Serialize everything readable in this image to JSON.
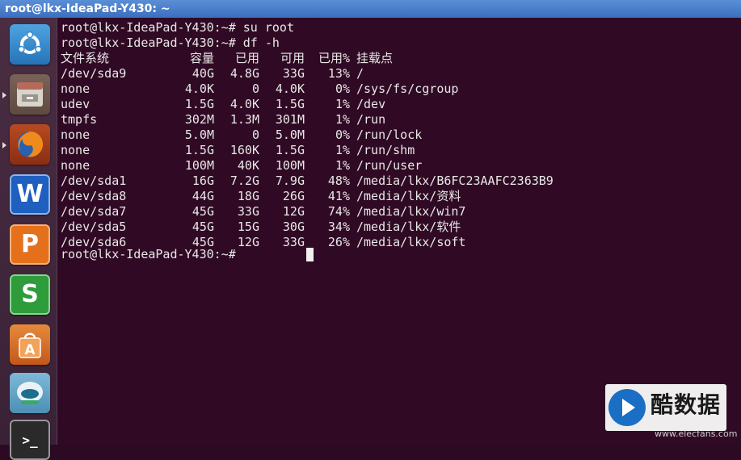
{
  "window": {
    "title": "root@lkx-IdeaPad-Y430: ~"
  },
  "launcher": {
    "items": [
      {
        "name": "ubuntu-dash-icon"
      },
      {
        "name": "files-icon"
      },
      {
        "name": "firefox-icon"
      },
      {
        "name": "wps-writer-icon",
        "letter": "W",
        "color": "#1e5fbf"
      },
      {
        "name": "wps-presentation-icon",
        "letter": "P",
        "color": "#e5701c"
      },
      {
        "name": "wps-spreadsheet-icon",
        "letter": "S",
        "color": "#2e9c3a"
      },
      {
        "name": "software-center-icon"
      },
      {
        "name": "system-updater-icon"
      },
      {
        "name": "terminal-icon",
        "glyph": ">_"
      }
    ]
  },
  "terminal": {
    "commands": [
      "root@lkx-IdeaPad-Y430:~# su root",
      "root@lkx-IdeaPad-Y430:~# df -h"
    ],
    "headers": [
      "文件系统",
      "容量",
      "已用",
      "可用",
      "已用%",
      "挂载点"
    ],
    "rows": [
      [
        "/dev/sda9",
        "40G",
        "4.8G",
        "33G",
        "13%",
        "/"
      ],
      [
        "none",
        "4.0K",
        "0",
        "4.0K",
        "0%",
        "/sys/fs/cgroup"
      ],
      [
        "udev",
        "1.5G",
        "4.0K",
        "1.5G",
        "1%",
        "/dev"
      ],
      [
        "tmpfs",
        "302M",
        "1.3M",
        "301M",
        "1%",
        "/run"
      ],
      [
        "none",
        "5.0M",
        "0",
        "5.0M",
        "0%",
        "/run/lock"
      ],
      [
        "none",
        "1.5G",
        "160K",
        "1.5G",
        "1%",
        "/run/shm"
      ],
      [
        "none",
        "100M",
        "40K",
        "100M",
        "1%",
        "/run/user"
      ],
      [
        "/dev/sda1",
        "16G",
        "7.2G",
        "7.9G",
        "48%",
        "/media/lkx/B6FC23AAFC2363B9"
      ],
      [
        "/dev/sda8",
        "44G",
        "18G",
        "26G",
        "41%",
        "/media/lkx/资料"
      ],
      [
        "/dev/sda7",
        "45G",
        "33G",
        "12G",
        "74%",
        "/media/lkx/win7"
      ],
      [
        "/dev/sda5",
        "45G",
        "15G",
        "30G",
        "34%",
        "/media/lkx/软件"
      ],
      [
        "/dev/sda6",
        "45G",
        "12G",
        "33G",
        "26%",
        "/media/lkx/soft"
      ]
    ],
    "prompt": "root@lkx-IdeaPad-Y430:~#"
  },
  "watermark": {
    "brand": "酷数据",
    "url": "www.elecfans.com"
  },
  "colors": {
    "terminal_bg": "#300a24",
    "text": "#e8e8e8",
    "titlebar": "#4a7fcf"
  }
}
